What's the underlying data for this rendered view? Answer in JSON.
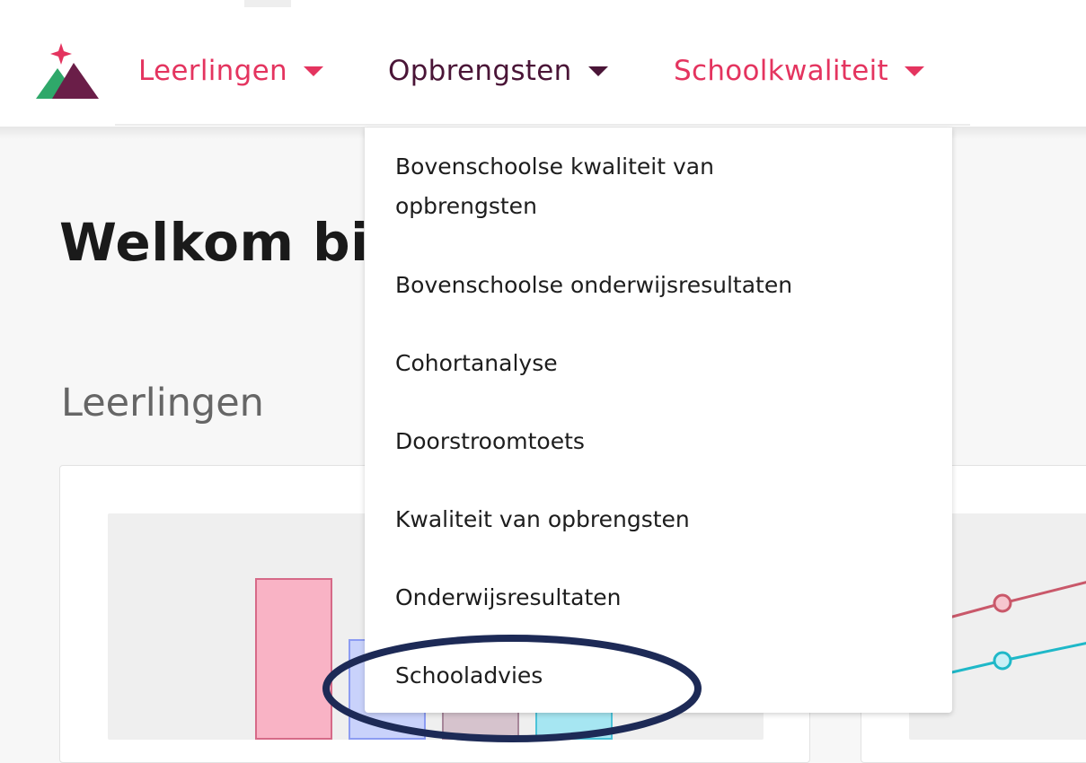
{
  "nav": {
    "leerlingen_label": "Leerlingen",
    "opbrengsten_label": "Opbrengsten",
    "schoolkwaliteit_label": "Schoolkwaliteit",
    "accent_color": "#e4345f",
    "active_color": "#4a1537"
  },
  "logo": {
    "icon": "mountain-logo-icon",
    "colors": [
      "#e4345f",
      "#2fa86a",
      "#6a1e48"
    ]
  },
  "main": {
    "page_title": "Welkom bij",
    "section_title": "Leerlingen"
  },
  "dropdown": {
    "items": [
      {
        "label": "Bovenschoolse kwaliteit van opbrengsten"
      },
      {
        "label": "Bovenschoolse onderwijsresultaten"
      },
      {
        "label": "Cohortanalyse"
      },
      {
        "label": "Doorstroomtoets"
      },
      {
        "label": "Kwaliteit van opbrengsten"
      },
      {
        "label": "Onderwijsresultaten"
      },
      {
        "label": "Schooladvies"
      }
    ],
    "circled_item": "Schooladvies",
    "circle_color": "#1d2a56"
  },
  "preview_colors": {
    "bar_pink": "#f9b3c5",
    "bar_blue": "#c9d2fb",
    "bar_mauve": "#d6c3cd",
    "bar_cyan": "#a6e6f2",
    "line_red": "#c9586a",
    "line_teal": "#1fb8c8"
  }
}
